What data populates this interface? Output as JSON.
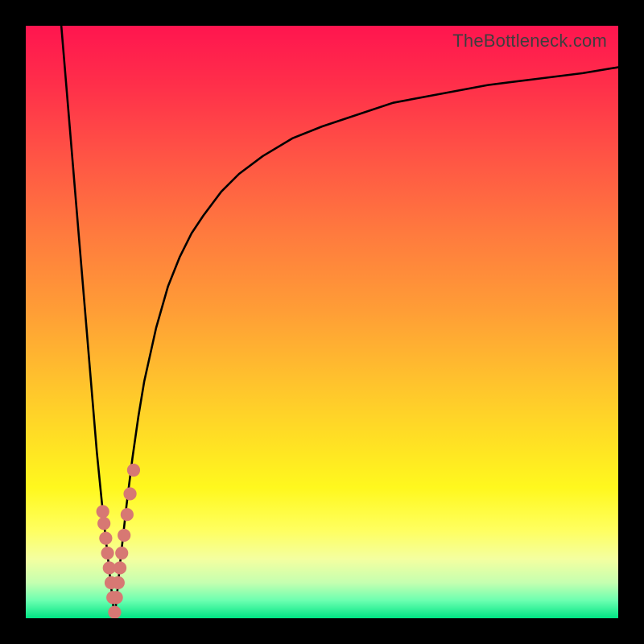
{
  "watermark": "TheBottleneck.com",
  "colors": {
    "frame": "#000000",
    "curve_stroke": "#000000",
    "highlight_stroke": "#d77873",
    "gradient_stops": [
      {
        "offset": 0.0,
        "color": "#ff154f"
      },
      {
        "offset": 0.1,
        "color": "#ff2f4a"
      },
      {
        "offset": 0.22,
        "color": "#ff5445"
      },
      {
        "offset": 0.35,
        "color": "#ff7a3e"
      },
      {
        "offset": 0.48,
        "color": "#ff9d36"
      },
      {
        "offset": 0.6,
        "color": "#ffc22d"
      },
      {
        "offset": 0.7,
        "color": "#ffe024"
      },
      {
        "offset": 0.78,
        "color": "#fff81e"
      },
      {
        "offset": 0.85,
        "color": "#ffff5e"
      },
      {
        "offset": 0.9,
        "color": "#f4ffa0"
      },
      {
        "offset": 0.94,
        "color": "#c5ffb0"
      },
      {
        "offset": 0.97,
        "color": "#6cffb0"
      },
      {
        "offset": 1.0,
        "color": "#00e584"
      }
    ]
  },
  "chart_data": {
    "type": "line",
    "title": "",
    "xlabel": "",
    "ylabel": "",
    "xlim": [
      0,
      100
    ],
    "ylim": [
      0,
      100
    ],
    "grid": false,
    "trough_x": 15,
    "series": [
      {
        "name": "left-branch",
        "x": [
          6,
          7,
          8,
          9,
          10,
          11,
          12,
          13,
          14,
          15
        ],
        "y": [
          100,
          88,
          76,
          64,
          52,
          40,
          28,
          18,
          9,
          0
        ]
      },
      {
        "name": "right-branch",
        "x": [
          15,
          16,
          17,
          18,
          19,
          20,
          22,
          24,
          26,
          28,
          30,
          33,
          36,
          40,
          45,
          50,
          56,
          62,
          70,
          78,
          86,
          94,
          100
        ],
        "y": [
          0,
          10,
          19,
          27,
          34,
          40,
          49,
          56,
          61,
          65,
          68,
          72,
          75,
          78,
          81,
          83,
          85,
          87,
          88.5,
          90,
          91,
          92,
          93
        ]
      },
      {
        "name": "highlight-cluster",
        "x": [
          13.0,
          13.2,
          13.5,
          13.8,
          14.1,
          14.4,
          14.7,
          15.0,
          15.3,
          15.6,
          15.9,
          16.2,
          16.6,
          17.1,
          17.6,
          18.2
        ],
        "y": [
          18.0,
          16.0,
          13.5,
          11.0,
          8.5,
          6.0,
          3.5,
          1.0,
          3.5,
          6.0,
          8.5,
          11.0,
          14.0,
          17.5,
          21.0,
          25.0
        ]
      }
    ]
  }
}
